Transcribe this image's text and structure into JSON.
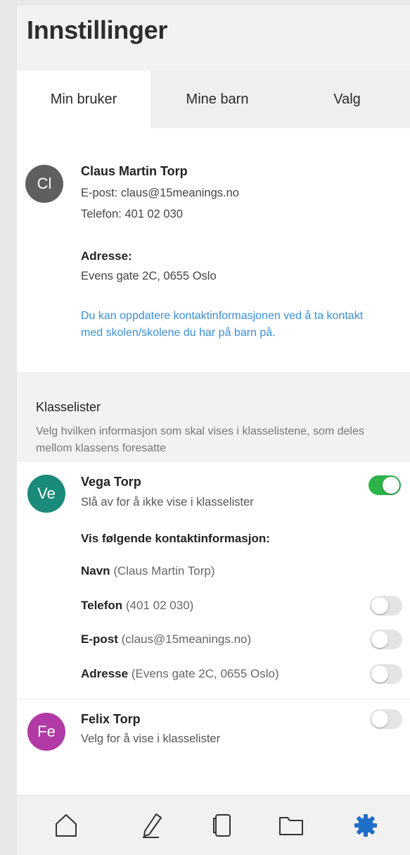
{
  "header": {
    "title": "Innstillinger"
  },
  "tabs": [
    {
      "label": "Min bruker",
      "active": true
    },
    {
      "label": "Mine barn",
      "active": false
    },
    {
      "label": "Valg",
      "active": false
    }
  ],
  "user": {
    "initials": "Cl",
    "avatar_color": "#5f5f5f",
    "name": "Claus Martin Torp",
    "email_line": "E-post: claus@15meanings.no",
    "phone_line": "Telefon: 401 02 030",
    "address_label": "Adresse:",
    "address": "Evens gate 2C, 0655 Oslo",
    "info_link": "Du kan oppdatere kontaktinformasjonen ved å ta kontakt med skolen/skolene du har på barn på."
  },
  "klasselister": {
    "title": "Klasselister",
    "description": "Velg hvilken informasjon som skal vises i klasselistene, som deles mellom klassens foresatte"
  },
  "children": [
    {
      "initials": "Ve",
      "avatar_color": "#1a8a7a",
      "name": "Vega Torp",
      "subtitle": "Slå av for å ikke vise i klasselister",
      "toggle_on": true,
      "contact_heading": "Vis følgende kontaktinformasjon:",
      "fields": [
        {
          "label": "Navn",
          "value": "(Claus Martin Torp)",
          "has_toggle": false
        },
        {
          "label": "Telefon",
          "value": "(401 02 030)",
          "has_toggle": true,
          "on": false
        },
        {
          "label": "E-post",
          "value": "(claus@15meanings.no)",
          "has_toggle": true,
          "on": false
        },
        {
          "label": "Adresse",
          "value": "(Evens gate 2C, 0655 Oslo)",
          "has_toggle": true,
          "on": false
        }
      ]
    },
    {
      "initials": "Fe",
      "avatar_color": "#b23aa6",
      "name": "Felix Torp",
      "subtitle": "Velg for å vise i klasselister",
      "toggle_on": false
    }
  ],
  "colors": {
    "toggle_on": "#2db34a",
    "link": "#3a8fd6",
    "active_tab_icon": "#1f6fc9",
    "inactive_icon": "#333333"
  },
  "tabbar": {
    "icons": [
      {
        "name": "home-icon",
        "active": false
      },
      {
        "name": "pencil-icon",
        "active": false
      },
      {
        "name": "document-icon",
        "active": false
      },
      {
        "name": "folder-icon",
        "active": false
      },
      {
        "name": "settings-gear-icon",
        "active": true
      }
    ]
  }
}
